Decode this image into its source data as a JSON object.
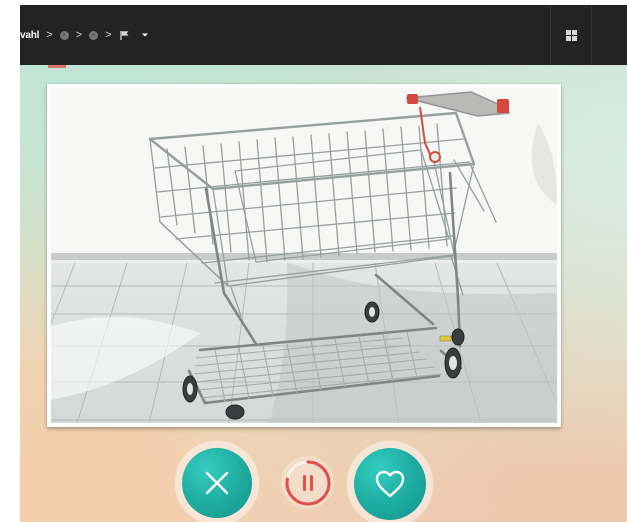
{
  "top_bar": {
    "breadcrumb": {
      "current_label": "vahl",
      "separator": ">",
      "steps": [
        {
          "icon": "status-circle-icon"
        },
        {
          "icon": "status-circle-icon"
        },
        {
          "icon": "flag-icon"
        }
      ],
      "dropdown_icon": "chevron-down-icon"
    },
    "view_toggle_icon": "grid-icon"
  },
  "main": {
    "image": {
      "subject": "shopping-cart-photo"
    }
  },
  "controls": {
    "dislike_icon": "close-icon",
    "timer": {
      "icon": "pause-icon",
      "progress": 0.78
    },
    "like_icon": "heart-icon"
  },
  "colors": {
    "topbar": "#232323",
    "teal": "#20afa2",
    "timer_red": "#e14f49",
    "accent": "#e26252"
  }
}
